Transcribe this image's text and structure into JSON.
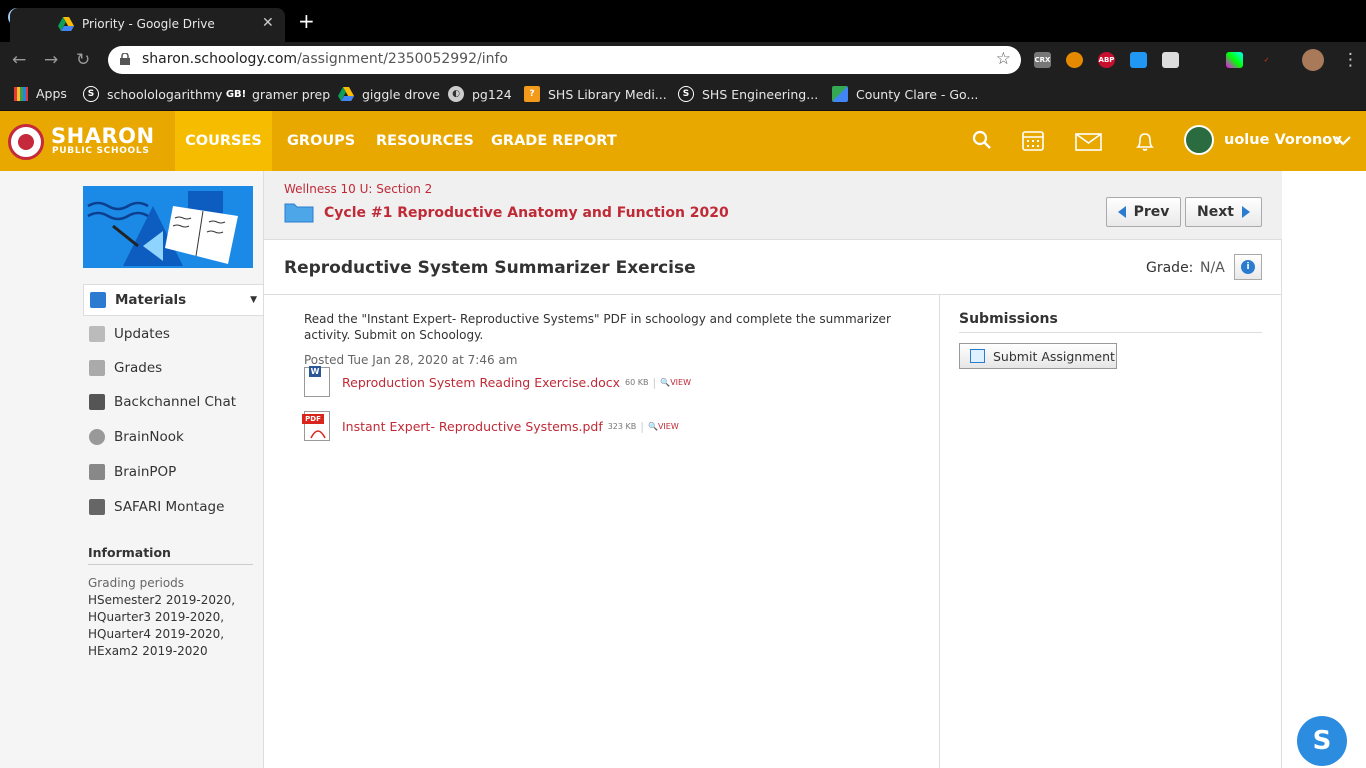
{
  "browser": {
    "tab_title": "Priority - Google Drive",
    "new_tab": "+",
    "close": "✕",
    "url_host": "sharon.schoology.com",
    "url_path": "/assignment/2350052992/info",
    "extensions": [
      "CRX",
      "ABP"
    ],
    "bookmarks": [
      "Apps",
      "schoolologarithmy",
      "gramer prep",
      "giggle drove",
      "pg124",
      "SHS Library Medi...",
      "SHS Engineering...",
      "County Clare - Go..."
    ],
    "bookmark_badge": "GB!"
  },
  "header": {
    "brand_line1": "SHARON",
    "brand_line2": "PUBLIC SCHOOLS",
    "nav": [
      "COURSES",
      "GROUPS",
      "RESOURCES",
      "GRADE REPORT"
    ],
    "user_name": "uolue Voronov",
    "accent_color": "#e8a800"
  },
  "sidebar": {
    "items": [
      "Materials",
      "Updates",
      "Grades",
      "Backchannel Chat",
      "BrainNook",
      "BrainPOP",
      "SAFARI Montage"
    ],
    "info_heading": "Information",
    "grading_label": "Grading periods",
    "grading_periods": [
      "HSemester2 2019-2020,",
      "HQuarter3 2019-2020,",
      "HQuarter4 2019-2020,",
      "HExam2 2019-2020"
    ]
  },
  "main": {
    "breadcrumb": "Wellness 10 U: Section 2",
    "folder_title": "Cycle #1 Reproductive Anatomy and Function 2020",
    "prev": "Prev",
    "next": "Next",
    "title": "Reproductive System Summarizer Exercise",
    "grade_label": "Grade:",
    "grade_value": "N/A",
    "description": "Read the \"Instant Expert- Reproductive Systems\" PDF in schoology and complete the summarizer activity. Submit on Schoology.",
    "posted": "Posted Tue Jan 28, 2020 at 7:46 am",
    "files": [
      {
        "name": "Reproduction System Reading Exercise.docx",
        "size": "60 KB",
        "view": "VIEW",
        "type": "W"
      },
      {
        "name": "Instant Expert- Reproductive Systems.pdf",
        "size": "323 KB",
        "view": "VIEW",
        "type": "PDF"
      }
    ]
  },
  "submissions": {
    "heading": "Submissions",
    "button": "Submit Assignment"
  },
  "fab_label": "S"
}
